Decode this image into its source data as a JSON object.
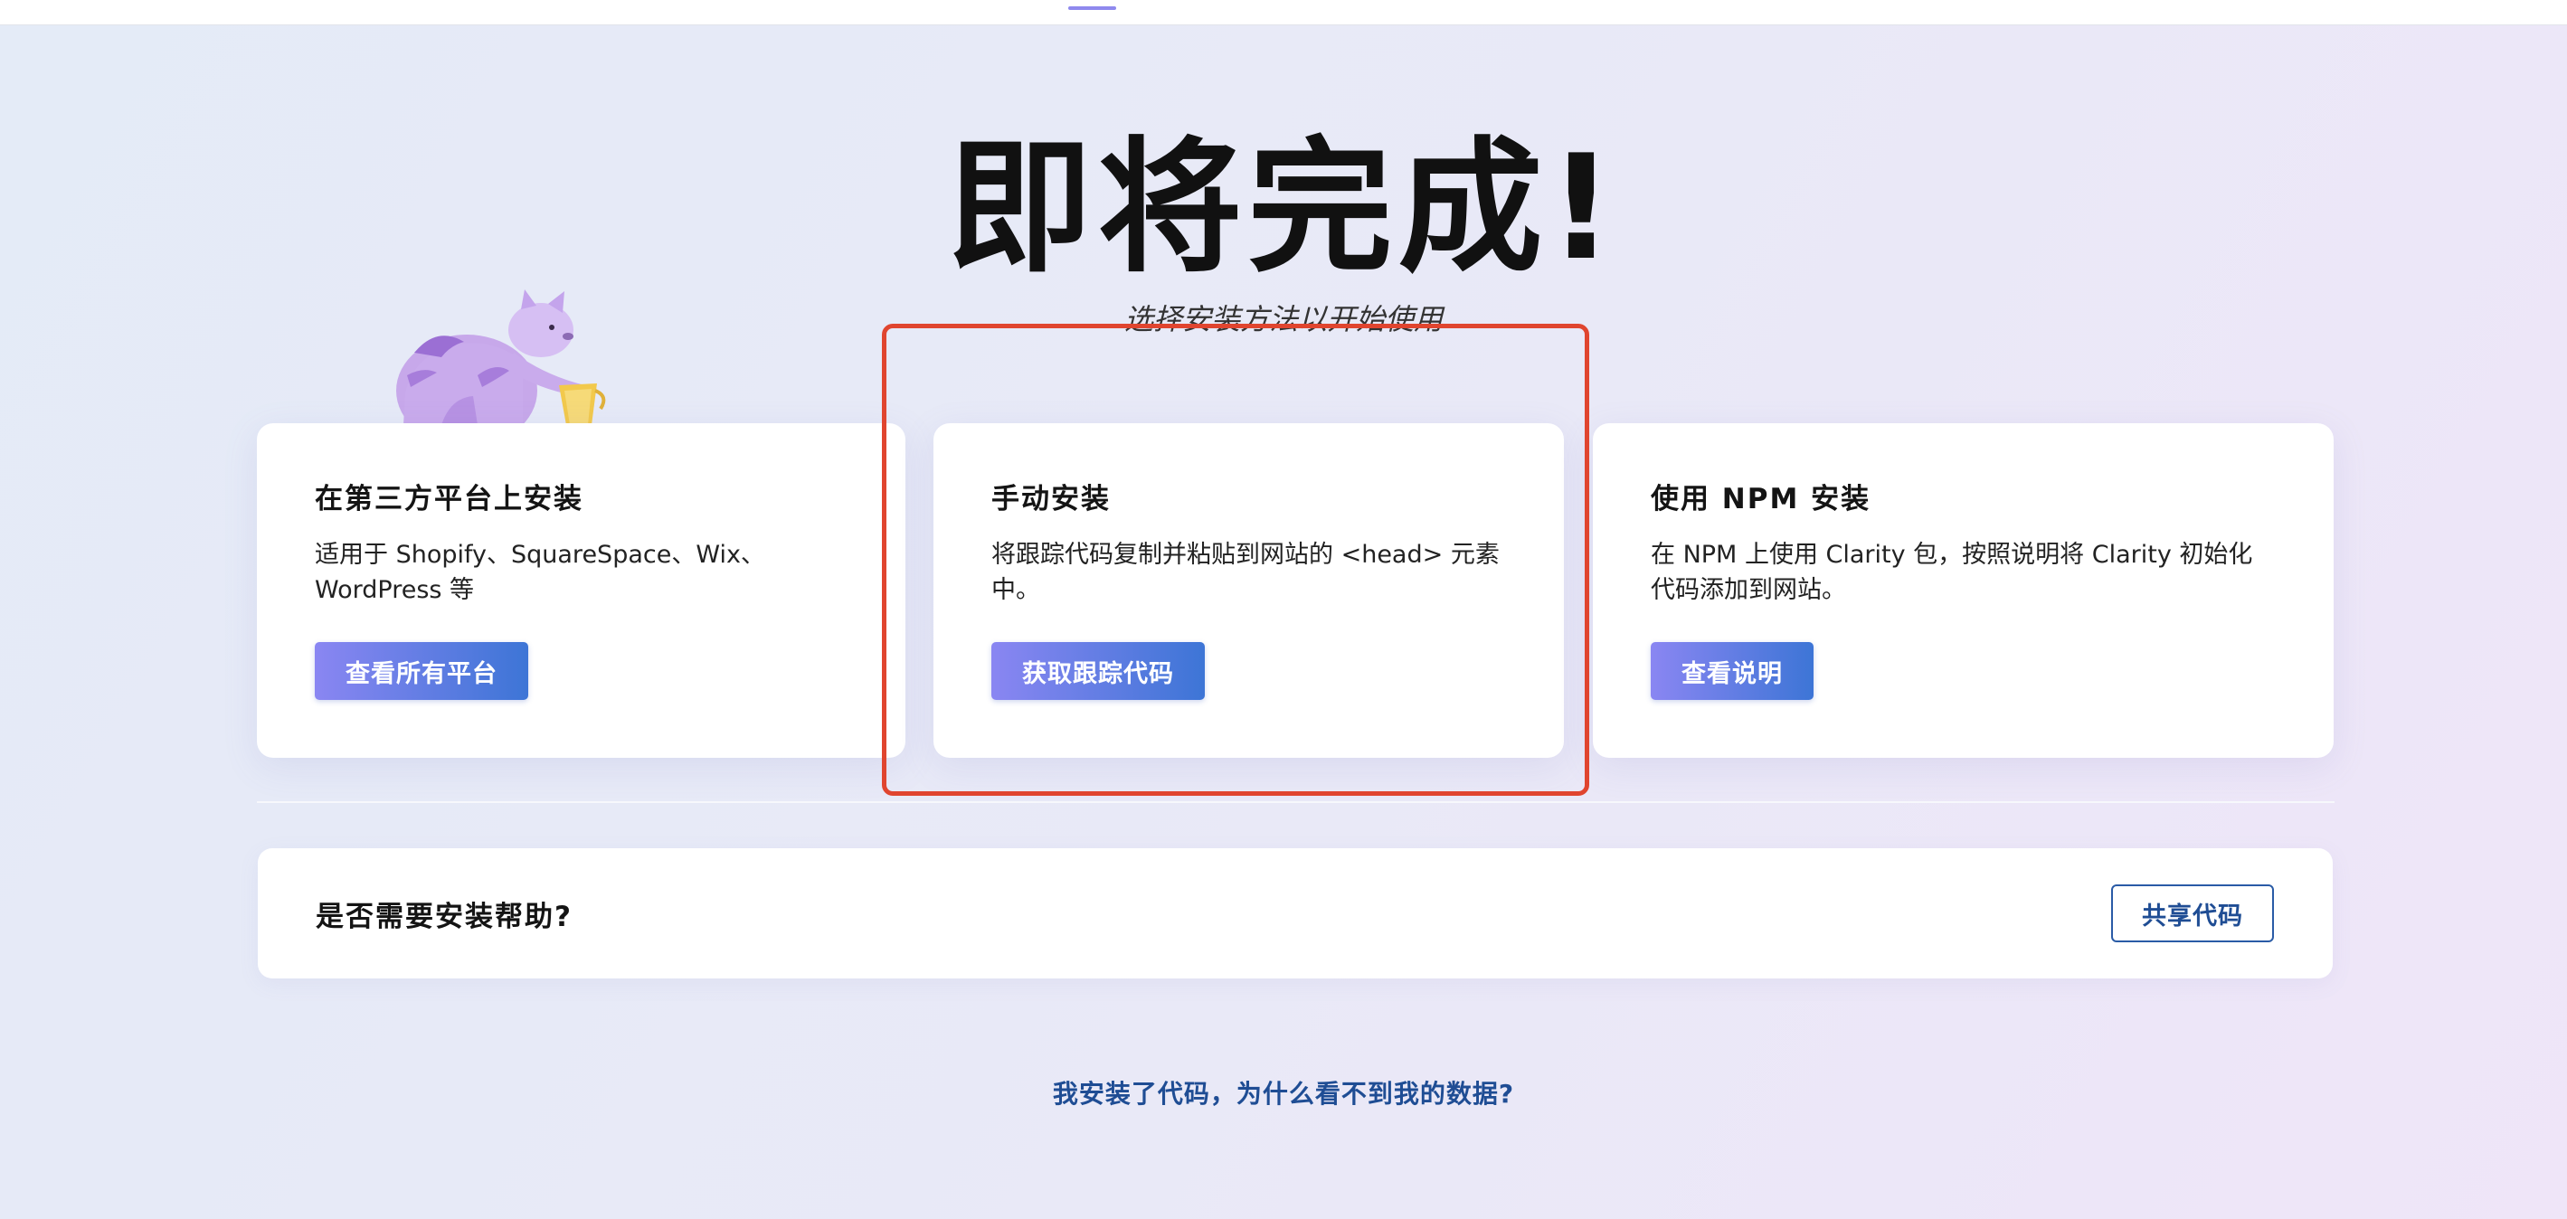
{
  "hero": {
    "title": "即将完成!",
    "subtitle": "选择安装方法以开始使用"
  },
  "cards": [
    {
      "title": "在第三方平台上安装",
      "description": "适用于 Shopify、SquareSpace、Wix、WordPress 等",
      "button": "查看所有平台"
    },
    {
      "title": "手动安装",
      "description": "将跟踪代码复制并粘贴到网站的 <head> 元素中。",
      "button": "获取跟踪代码"
    },
    {
      "title": "使用 NPM 安装",
      "description": "在 NPM 上使用 Clarity 包，按照说明将 Clarity 初始化代码添加到网站。",
      "button": "查看说明"
    }
  ],
  "help": {
    "title": "是否需要安装帮助?",
    "share_button": "共享代码"
  },
  "faq_link": "我安装了代码，为什么看不到我的数据?",
  "colors": {
    "accent_gradient_start": "#8a86f2",
    "accent_gradient_end": "#3d75d6",
    "link": "#1f4d94",
    "highlight": "#e0452f"
  },
  "icons": {
    "mascot": "cat-mascot-illustration"
  }
}
